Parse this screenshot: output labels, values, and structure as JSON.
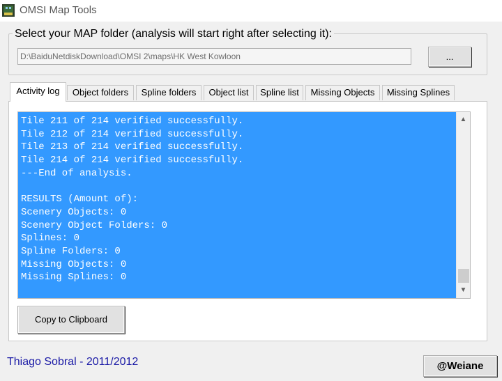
{
  "window": {
    "title": "OMSI Map Tools"
  },
  "folder_group": {
    "caption": "Select your MAP folder (analysis will start right after selecting it):",
    "path_value": "D:\\BaiduNetdiskDownload\\OMSI 2\\maps\\HK West Kowloon",
    "browse_label": "..."
  },
  "tabs": [
    {
      "label": "Activity log",
      "active": true
    },
    {
      "label": "Object folders",
      "active": false
    },
    {
      "label": "Spline folders",
      "active": false
    },
    {
      "label": "Object list",
      "active": false
    },
    {
      "label": "Spline list",
      "active": false
    },
    {
      "label": "Missing Objects",
      "active": false
    },
    {
      "label": "Missing Splines",
      "active": false
    }
  ],
  "log": {
    "lines": [
      "Tile 211 of 214 verified successfully.",
      "Tile 212 of 214 verified successfully.",
      "Tile 213 of 214 verified successfully.",
      "Tile 214 of 214 verified successfully.",
      "---End of analysis.",
      "",
      "RESULTS (Amount of):",
      "Scenery Objects: 0",
      "Scenery Object Folders: 0",
      "Splines: 0",
      "Spline Folders: 0",
      "Missing Objects: 0",
      "Missing Splines: 0"
    ],
    "background": "#3399ff"
  },
  "copy_button": {
    "label": "Copy to Clipboard"
  },
  "footer": {
    "credit": "Thiago Sobral - 2011/2012",
    "credit_color": "#1a1aa6",
    "button_label": "@Weiane"
  },
  "icons": {
    "app": "app-icon",
    "scroll_up": "chevron-up-icon",
    "scroll_down": "chevron-down-icon"
  }
}
